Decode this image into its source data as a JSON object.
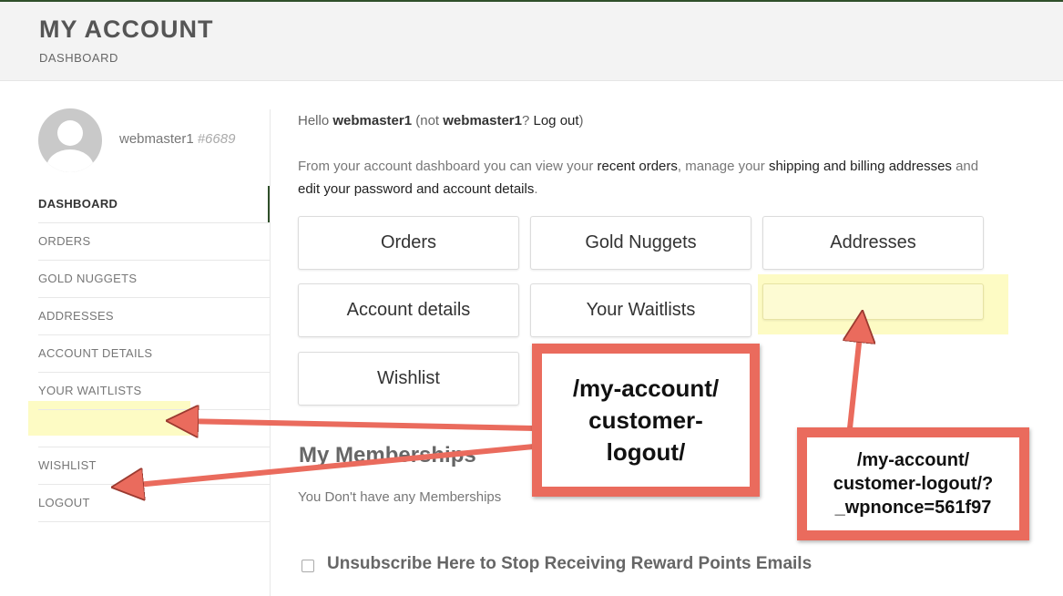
{
  "header": {
    "title": "MY ACCOUNT",
    "subtitle": "DASHBOARD"
  },
  "user": {
    "name": "webmaster1",
    "id": "#6689"
  },
  "sidebar": {
    "items": [
      {
        "label": "DASHBOARD",
        "active": true
      },
      {
        "label": "ORDERS"
      },
      {
        "label": "GOLD NUGGETS"
      },
      {
        "label": "ADDRESSES"
      },
      {
        "label": "ACCOUNT DETAILS"
      },
      {
        "label": "YOUR WAITLISTS"
      },
      {
        "label": ""
      },
      {
        "label": "WISHLIST"
      },
      {
        "label": "LOGOUT"
      }
    ]
  },
  "greeting": {
    "hello": "Hello ",
    "name": "webmaster1",
    "not": " (not ",
    "name2": "webmaster1",
    "question": "? ",
    "logout": "Log out",
    "close": ")"
  },
  "intro": {
    "p1": "From your account dashboard you can view your ",
    "recent_orders": "recent orders",
    "p2": ", manage your ",
    "addresses": "shipping and billing addresses",
    "p3": " and ",
    "account_details": "edit your password and account details",
    "p4": "."
  },
  "tiles": {
    "orders": "Orders",
    "gold_nuggets": "Gold Nuggets",
    "addresses": "Addresses",
    "account_details": "Account details",
    "waitlists": "Your Waitlists",
    "blank": "",
    "wishlist": "Wishlist"
  },
  "memberships": {
    "title": "My Memberships",
    "text": "You Don't have any Memberships"
  },
  "unsubscribe": {
    "label": "Unsubscribe Here to Stop Receiving Reward Points Emails"
  },
  "annotations": {
    "callout1": "/my-account/\ncustomer-\nlogout/",
    "callout2": "/my-account/\ncustomer-logout/?\n_wpnonce=561f97",
    "arrow_color": "#ea6b5d",
    "highlight_color": "#fdfbc4"
  }
}
